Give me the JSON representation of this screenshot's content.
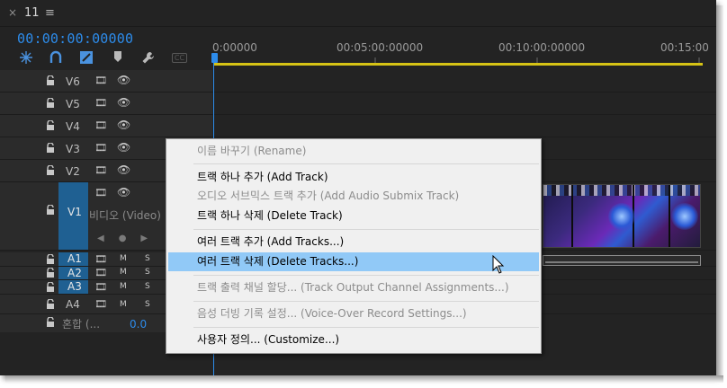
{
  "tab": {
    "close": "×",
    "title": "11",
    "menu": "≡"
  },
  "timecode": "00:00:00:00000",
  "ruler": {
    "labels": [
      "0:00000",
      "00:05:00:00000",
      "00:10:00:00000",
      "00:15:00"
    ]
  },
  "tools": {
    "snap_icon": "snap-icon",
    "link_icon": "linked-selection-icon",
    "marker_icon": "marker-icon",
    "settings_icon": "wrench-icon",
    "captions": "CC"
  },
  "tracks": {
    "video": [
      "V6",
      "V5",
      "V4",
      "V3",
      "V2"
    ],
    "v1": {
      "patch": "V1",
      "label": "V1",
      "name": "비디오 (Video)"
    },
    "audio": [
      {
        "patch": "A1",
        "mute": "M",
        "solo": "S"
      },
      {
        "patch": "A2",
        "mute": "M",
        "solo": "S"
      },
      {
        "patch": "A3",
        "mute": "M",
        "solo": "S"
      },
      {
        "patch": "",
        "label": "A4",
        "mute": "M",
        "solo": "S"
      }
    ],
    "mix": {
      "label": "혼합 (...",
      "value": "0.0"
    }
  },
  "context_menu": {
    "items": [
      {
        "label": "이름 바꾸기 (Rename)",
        "enabled": false
      },
      {
        "label": "트랙 하나 추가 (Add Track)",
        "enabled": true
      },
      {
        "label": "오디오 서브믹스 트랙 추가 (Add Audio Submix Track)",
        "enabled": false
      },
      {
        "label": "트랙 하나 삭제 (Delete Track)",
        "enabled": true
      },
      {
        "label": "여러 트랙 추가 (Add Tracks...)",
        "enabled": true
      },
      {
        "label": "여러 트랙 삭제 (Delete Tracks...)",
        "enabled": true,
        "highlighted": true
      },
      {
        "label": "트랙 출력 채널 할당... (Track Output Channel Assignments...)",
        "enabled": false
      },
      {
        "label": "음성 더빙 기록 설정... (Voice-Over Record Settings...)",
        "enabled": false
      },
      {
        "label": "사용자 정의... (Customize...)",
        "enabled": true
      }
    ]
  },
  "colors": {
    "accent": "#2d8ceb",
    "work_area": "#d6c315",
    "patch": "#1f6092",
    "menu_highlight": "#91c9f7"
  }
}
